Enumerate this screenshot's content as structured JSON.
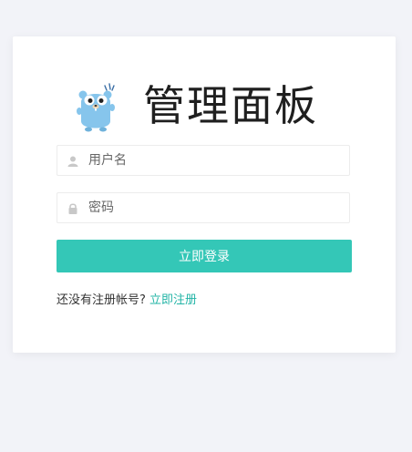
{
  "header": {
    "title": "管理面板",
    "logo": "gopher-logo"
  },
  "form": {
    "username": {
      "placeholder": "用户名",
      "value": "",
      "icon": "user-icon"
    },
    "password": {
      "placeholder": "密码",
      "value": "",
      "icon": "lock-icon"
    },
    "submit_label": "立即登录"
  },
  "footer": {
    "prompt": "还没有注册帐号? ",
    "register_link": "立即注册"
  },
  "colors": {
    "accent": "#34c7b7",
    "link": "#22b4a6",
    "background": "#f2f3f8"
  }
}
